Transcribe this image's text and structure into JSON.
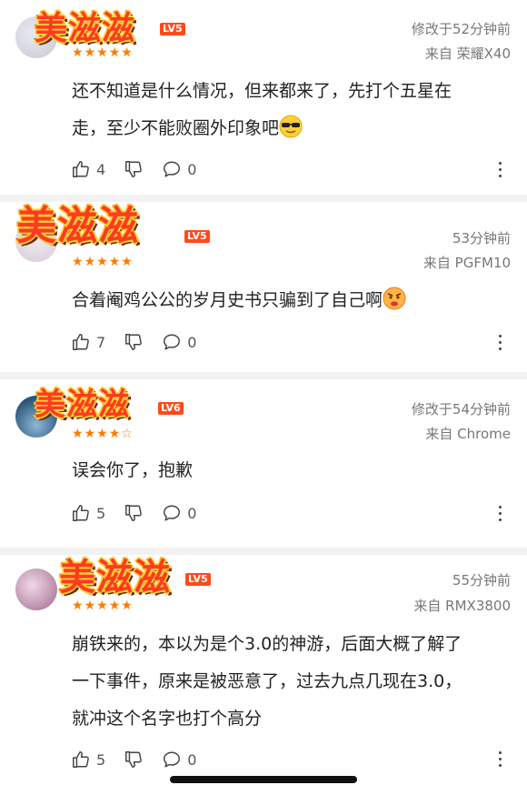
{
  "comments": [
    {
      "nickname": "美滋滋",
      "level": "LV5",
      "rating": 5,
      "time": "修改于52分钟前",
      "source": "来自 荣耀X40",
      "lines": [
        "还不知道是什么情况，但来都来了，先打个五星在",
        "走，至少不能败圈外印象吧"
      ],
      "emoji": "sunglasses-emoji",
      "likes": "4",
      "replies": "0"
    },
    {
      "nickname": "美滋滋",
      "level": "LV5",
      "rating": 5,
      "time": "53分钟前",
      "source": "来自 PGFM10",
      "lines": [
        "合着阉鸡公公的岁月史书只骗到了自己啊"
      ],
      "emoji": "angry-emoji",
      "likes": "7",
      "replies": "0"
    },
    {
      "nickname": "美滋滋",
      "level": "LV6",
      "rating": 4,
      "time": "修改于54分钟前",
      "source": "来自 Chrome",
      "lines": [
        "误会你了，抱歉"
      ],
      "likes": "5",
      "replies": "0"
    },
    {
      "nickname": "美滋滋",
      "level": "LV5",
      "rating": 5,
      "time": "55分钟前",
      "source": "来自 RMX3800",
      "lines": [
        "崩铁来的，本以为是个3.0的神游，后面大概了解了",
        "一下事件，原来是被恶意了，过去九点几现在3.0，",
        "就冲这个名字也打个高分"
      ],
      "likes": "5",
      "replies": "0"
    }
  ],
  "colors": {
    "star": "#ff7a00",
    "level_badge": "#ff4a1a",
    "nickname": "#ff3b1f",
    "divider": "#f2f2f2"
  },
  "icons": [
    "thumb-up-icon",
    "thumb-down-icon",
    "comment-bubble-icon",
    "more-vertical-icon"
  ]
}
